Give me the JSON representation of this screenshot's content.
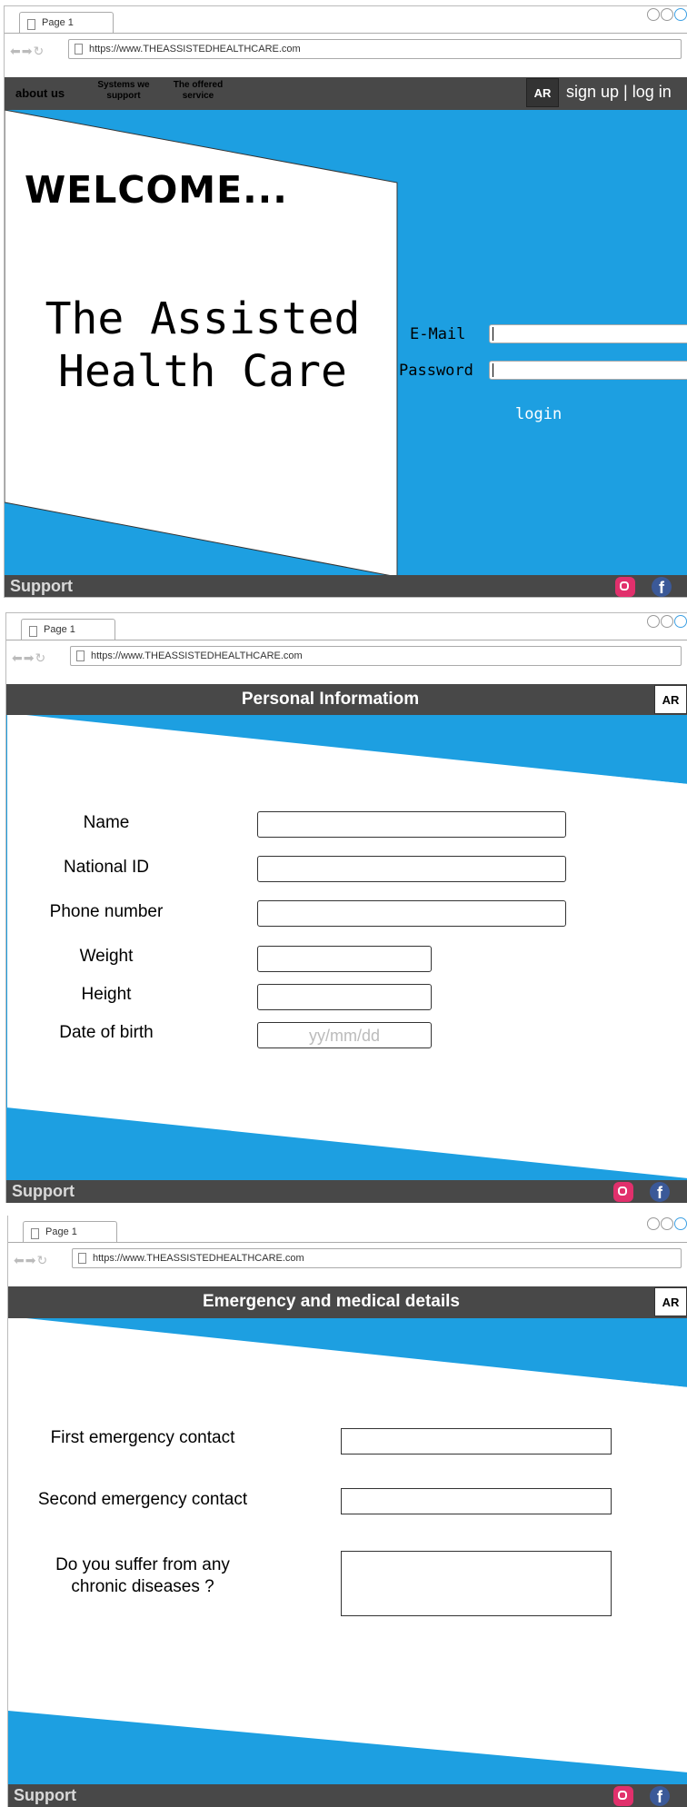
{
  "colors": {
    "accent": "#1d9fe1",
    "bar": "#484848",
    "footer_text": "#d9d9d9"
  },
  "browser": {
    "tab_title": "Page 1",
    "url": "https://www.THEASSISTEDHEALTHCARE.com"
  },
  "page1": {
    "nav": {
      "about": "about us",
      "systems": "Systems we support",
      "offered": "The offered service",
      "lang": "AR",
      "auth": "sign up | log in"
    },
    "welcome": "WELCOME...",
    "brand_line1": "The Assisted",
    "brand_line2": "Health Care",
    "email_label": "E-Mail",
    "password_label": "Password",
    "login_label": "login"
  },
  "page2": {
    "title": "Personal Informatiom",
    "lang": "AR",
    "fields": {
      "name": "Name",
      "national_id": "National ID",
      "phone": "Phone number",
      "weight": "Weight",
      "height": "Height",
      "dob": "Date of birth"
    },
    "dob_placeholder": "yy/mm/dd"
  },
  "page3": {
    "title": "Emergency and medical details",
    "lang": "AR",
    "first_contact": "First emergency contact",
    "second_contact": "Second emergency contact",
    "chronic_line1": "Do you suffer from any",
    "chronic_line2": "chronic diseases ?"
  },
  "footer": {
    "support": "Support",
    "instagram_icon": "instagram-icon",
    "facebook_icon": "facebook-icon"
  }
}
